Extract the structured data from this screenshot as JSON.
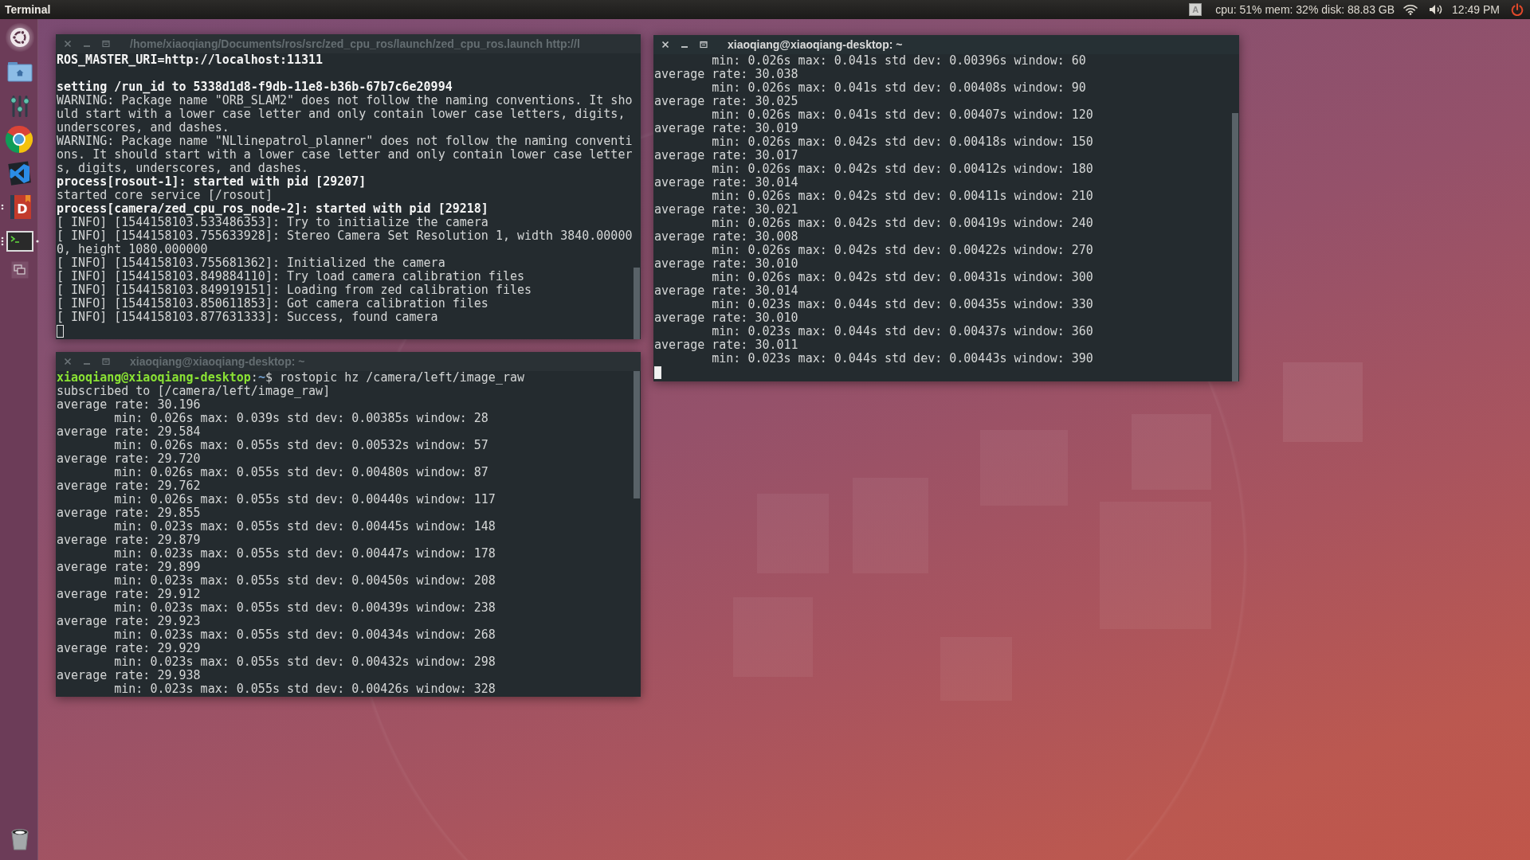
{
  "panel": {
    "app_name": "Terminal",
    "keyboard_indicator": "A",
    "system_monitor": "cpu: 51% mem: 32% disk: 88.83 GB",
    "clock": "12:49 PM"
  },
  "launcher": {
    "items": [
      {
        "kind": "dash"
      },
      {
        "kind": "home-folder"
      },
      {
        "kind": "mixer"
      },
      {
        "kind": "browser"
      },
      {
        "kind": "editor"
      },
      {
        "kind": "book",
        "glyph": "D",
        "running": true,
        "many_windows": false
      },
      {
        "kind": "terminal",
        "running": true,
        "many_windows": true,
        "focused": true
      },
      {
        "kind": "workspaces"
      },
      {
        "kind": "trash"
      }
    ]
  },
  "windows": [
    {
      "title": "/home/xiaoqiang/Documents/ros/src/zed_cpu_ros/launch/zed_cpu_ros.launch http://l",
      "focused": false,
      "cursor": true,
      "lines": [
        {
          "text": "ROS_MASTER_URI=http://localhost:11311",
          "bold": true
        },
        {
          "text": "setting /run_id to 5338d1d8-f9db-11e8-b36b-67b7c6e20994",
          "bold": true,
          "gap_before": true
        },
        {
          "text": "WARNING: Package name \"ORB_SLAM2\" does not follow the naming conventions. It sho",
          "bold": false
        },
        {
          "text": "uld start with a lower case letter and only contain lower case letters, digits,",
          "bold": false
        },
        {
          "text": "underscores, and dashes.",
          "bold": false
        },
        {
          "text": "WARNING: Package name \"NLlinepatrol_planner\" does not follow the naming conventi",
          "bold": false
        },
        {
          "text": "ons. It should start with a lower case letter and only contain lower case letter",
          "bold": false
        },
        {
          "text": "s, digits, underscores, and dashes.",
          "bold": false
        },
        {
          "text": "process[rosout-1]: started with pid [29207]",
          "bold": true
        },
        {
          "text": "started core service [/rosout]",
          "bold": false
        },
        {
          "text": "process[camera/zed_cpu_ros_node-2]: started with pid [29218]",
          "bold": true
        },
        {
          "text": "[ INFO] [1544158103.533486353]: Try to initialize the camera",
          "bold": false
        },
        {
          "text": "[ INFO] [1544158103.755633928]: Stereo Camera Set Resolution 1, width 3840.00000",
          "bold": false
        },
        {
          "text": "0, height 1080.000000",
          "bold": false
        },
        {
          "text": "[ INFO] [1544158103.755681362]: Initialized the camera",
          "bold": false
        },
        {
          "text": "[ INFO] [1544158103.849884110]: Try load camera calibration files",
          "bold": false
        },
        {
          "text": "[ INFO] [1544158103.849919151]: Loading from zed calibration files",
          "bold": false
        },
        {
          "text": "[ INFO] [1544158103.850611853]: Got camera calibration files",
          "bold": false
        },
        {
          "text": "[ INFO] [1544158103.877631333]: Success, found camera",
          "bold": false
        }
      ]
    },
    {
      "title": "xiaoqiang@xiaoqiang-desktop: ~",
      "focused": false,
      "lines": [
        {
          "segments": [
            {
              "kind": "user",
              "text": "xiaoqiang@xiaoqiang-desktop"
            },
            {
              "kind": "plain",
              "text": ":"
            },
            {
              "kind": "path",
              "text": "~"
            },
            {
              "kind": "plain",
              "text": "$ rostopic hz /camera/left/image_raw"
            }
          ]
        },
        {
          "text": "subscribed to [/camera/left/image_raw]"
        },
        {
          "text": "average rate: 30.196"
        },
        {
          "text": "min: 0.026s max: 0.039s std dev: 0.00385s window: 28",
          "indent": true
        },
        {
          "text": "average rate: 29.584"
        },
        {
          "text": "min: 0.026s max: 0.055s std dev: 0.00532s window: 57",
          "indent": true
        },
        {
          "text": "average rate: 29.720"
        },
        {
          "text": "min: 0.026s max: 0.055s std dev: 0.00480s window: 87",
          "indent": true
        },
        {
          "text": "average rate: 29.762"
        },
        {
          "text": "min: 0.026s max: 0.055s std dev: 0.00440s window: 117",
          "indent": true
        },
        {
          "text": "average rate: 29.855"
        },
        {
          "text": "min: 0.023s max: 0.055s std dev: 0.00445s window: 148",
          "indent": true
        },
        {
          "text": "average rate: 29.879"
        },
        {
          "text": "min: 0.023s max: 0.055s std dev: 0.00447s window: 178",
          "indent": true
        },
        {
          "text": "average rate: 29.899"
        },
        {
          "text": "min: 0.023s max: 0.055s std dev: 0.00450s window: 208",
          "indent": true
        },
        {
          "text": "average rate: 29.912"
        },
        {
          "text": "min: 0.023s max: 0.055s std dev: 0.00439s window: 238",
          "indent": true
        },
        {
          "text": "average rate: 29.923"
        },
        {
          "text": "min: 0.023s max: 0.055s std dev: 0.00434s window: 268",
          "indent": true
        },
        {
          "text": "average rate: 29.929"
        },
        {
          "text": "min: 0.023s max: 0.055s std dev: 0.00432s window: 298",
          "indent": true
        },
        {
          "text": "average rate: 29.938"
        },
        {
          "text": "min: 0.023s max: 0.055s std dev: 0.00426s window: 328",
          "indent": true
        }
      ]
    },
    {
      "title": "xiaoqiang@xiaoqiang-desktop: ~",
      "focused": true,
      "cursor": true,
      "lines": [
        {
          "text": "min: 0.026s max: 0.041s std dev: 0.00396s window: 60",
          "indent": true
        },
        {
          "text": "average rate: 30.038"
        },
        {
          "text": "min: 0.026s max: 0.041s std dev: 0.00408s window: 90",
          "indent": true
        },
        {
          "text": "average rate: 30.025"
        },
        {
          "text": "min: 0.026s max: 0.041s std dev: 0.00407s window: 120",
          "indent": true
        },
        {
          "text": "average rate: 30.019"
        },
        {
          "text": "min: 0.026s max: 0.042s std dev: 0.00418s window: 150",
          "indent": true
        },
        {
          "text": "average rate: 30.017"
        },
        {
          "text": "min: 0.026s max: 0.042s std dev: 0.00412s window: 180",
          "indent": true
        },
        {
          "text": "average rate: 30.014"
        },
        {
          "text": "min: 0.026s max: 0.042s std dev: 0.00411s window: 210",
          "indent": true
        },
        {
          "text": "average rate: 30.021"
        },
        {
          "text": "min: 0.026s max: 0.042s std dev: 0.00419s window: 240",
          "indent": true
        },
        {
          "text": "average rate: 30.008"
        },
        {
          "text": "min: 0.026s max: 0.042s std dev: 0.00422s window: 270",
          "indent": true
        },
        {
          "text": "average rate: 30.010"
        },
        {
          "text": "min: 0.026s max: 0.042s std dev: 0.00431s window: 300",
          "indent": true
        },
        {
          "text": "average rate: 30.014"
        },
        {
          "text": "min: 0.023s max: 0.044s std dev: 0.00435s window: 330",
          "indent": true
        },
        {
          "text": "average rate: 30.010"
        },
        {
          "text": "min: 0.023s max: 0.044s std dev: 0.00437s window: 360",
          "indent": true
        },
        {
          "text": "average rate: 30.011"
        },
        {
          "text": "min: 0.023s max: 0.044s std dev: 0.00443s window: 390",
          "indent": true
        }
      ]
    }
  ]
}
